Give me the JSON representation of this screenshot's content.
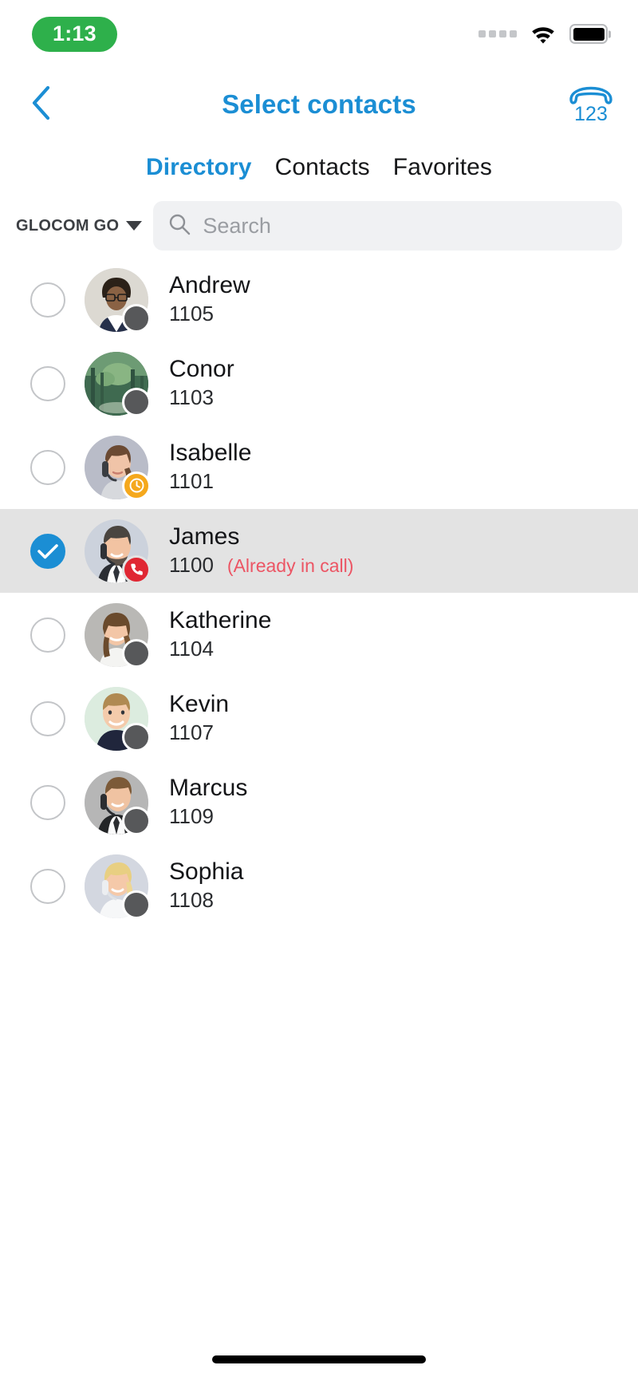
{
  "status_bar": {
    "time": "1:13",
    "time_pill_color": "#2eb04b",
    "signal_icon": "signal-dots-icon",
    "wifi_icon": "wifi-icon",
    "battery_icon": "battery-full-icon"
  },
  "navbar": {
    "back_icon": "chevron-left-icon",
    "title": "Select contacts",
    "title_color": "#1b8ed4",
    "dialpad_icon": "dialpad-123-icon",
    "dialpad_label": "123"
  },
  "tabs": [
    {
      "label": "Directory",
      "active": true
    },
    {
      "label": "Contacts",
      "active": false
    },
    {
      "label": "Favorites",
      "active": false
    }
  ],
  "filter": {
    "group_label": "GLOCOM GO",
    "caret_icon": "chevron-down-icon"
  },
  "search": {
    "icon": "search-icon",
    "value": "",
    "placeholder": "Search"
  },
  "contacts": [
    {
      "name": "Andrew",
      "extension": "1105",
      "status": "offline",
      "status_icon": "offline-dot-icon",
      "selected": false,
      "note": ""
    },
    {
      "name": "Conor",
      "extension": "1103",
      "status": "offline",
      "status_icon": "offline-dot-icon",
      "selected": false,
      "note": ""
    },
    {
      "name": "Isabelle",
      "extension": "1101",
      "status": "away",
      "status_icon": "clock-icon",
      "selected": false,
      "note": ""
    },
    {
      "name": "James",
      "extension": "1100",
      "status": "incall",
      "status_icon": "phone-icon",
      "selected": true,
      "note": "(Already in call)"
    },
    {
      "name": "Katherine",
      "extension": "1104",
      "status": "offline",
      "status_icon": "offline-dot-icon",
      "selected": false,
      "note": ""
    },
    {
      "name": "Kevin",
      "extension": "1107",
      "status": "offline",
      "status_icon": "offline-dot-icon",
      "selected": false,
      "note": ""
    },
    {
      "name": "Marcus",
      "extension": "1109",
      "status": "offline",
      "status_icon": "offline-dot-icon",
      "selected": false,
      "note": ""
    },
    {
      "name": "Sophia",
      "extension": "1108",
      "status": "offline",
      "status_icon": "offline-dot-icon",
      "selected": false,
      "note": ""
    }
  ],
  "colors": {
    "accent": "#1b8ed4",
    "selected_row": "#e3e3e3",
    "note_red": "#ec5564",
    "away_amber": "#f5a81c",
    "incall_red": "#e02733",
    "offline_gray": "#57585a"
  },
  "home_indicator": "home-indicator"
}
